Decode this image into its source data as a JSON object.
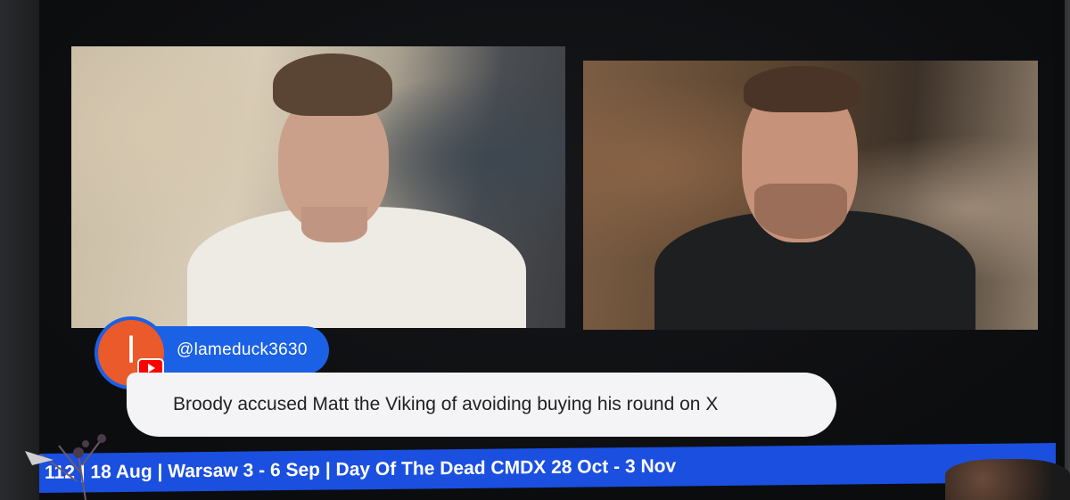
{
  "chat": {
    "avatar_letter": "l",
    "username": "@lameduck3630",
    "message": "Broody accused Matt the Viking of avoiding buying his round on X"
  },
  "ticker": {
    "text": "112 | 18 Aug | Warsaw 3 - 6 Sep | Day Of The Dead CMDX 28 Oct - 3 Nov"
  },
  "colors": {
    "accent_blue": "#1a61e6",
    "avatar_orange": "#ea5a2b",
    "ticker_blue": "#1a4fe0",
    "bubble_bg": "#f4f4f6"
  },
  "icons": {
    "platform_badge": "youtube-icon"
  }
}
